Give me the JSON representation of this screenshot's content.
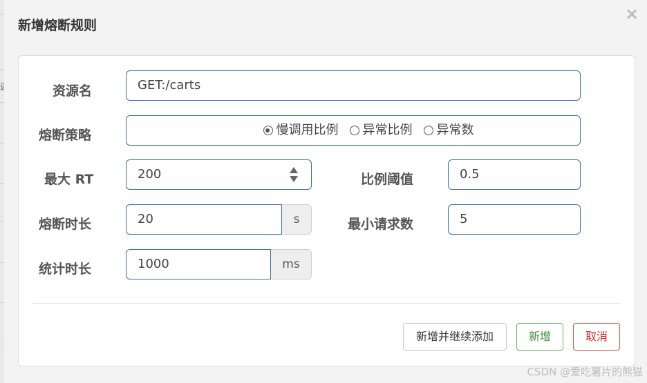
{
  "dialog": {
    "title": "新增熔断规则",
    "close_symbol": "×"
  },
  "background": {
    "glyph": "运"
  },
  "form": {
    "resource": {
      "label": "资源名",
      "value": "GET:/carts"
    },
    "strategy": {
      "label": "熔断策略",
      "options": [
        {
          "label": "慢调用比例",
          "checked": true
        },
        {
          "label": "异常比例",
          "checked": false
        },
        {
          "label": "异常数",
          "checked": false
        }
      ]
    },
    "max_rt": {
      "label": "最大 RT",
      "value": "200"
    },
    "ratio_threshold": {
      "label": "比例阈值",
      "value": "0.5"
    },
    "duration": {
      "label": "熔断时长",
      "value": "20",
      "unit": "s"
    },
    "min_requests": {
      "label": "最小请求数",
      "value": "5"
    },
    "stat_duration": {
      "label": "统计时长",
      "value": "1000",
      "unit": "ms"
    }
  },
  "buttons": {
    "add_continue": "新增并继续添加",
    "add": "新增",
    "cancel": "取消"
  },
  "watermark": "CSDN @爱吃薯片的熊猫",
  "colors": {
    "input_border": "#3c6ea5",
    "success": "#5cb85c",
    "danger": "#d9534f"
  }
}
